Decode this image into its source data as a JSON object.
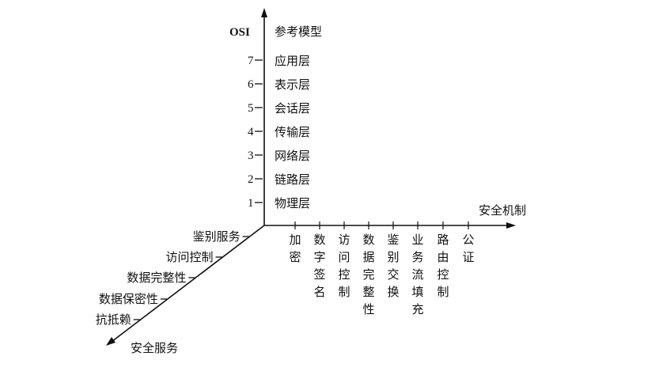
{
  "osi_axis": {
    "name": "OSI",
    "title": "参考模型",
    "layers": [
      {
        "number": "7",
        "label": "应用层"
      },
      {
        "number": "6",
        "label": "表示层"
      },
      {
        "number": "5",
        "label": "会话层"
      },
      {
        "number": "4",
        "label": "传输层"
      },
      {
        "number": "3",
        "label": "网络层"
      },
      {
        "number": "2",
        "label": "链路层"
      },
      {
        "number": "1",
        "label": "物理层"
      }
    ]
  },
  "mechanism_axis": {
    "title": "安全机制",
    "items": [
      "加密",
      "数字签名",
      "访问控制",
      "数据完整性",
      "鉴别交换",
      "业务流填充",
      "路由控制",
      "公证"
    ]
  },
  "service_axis": {
    "title": "安全服务",
    "items": [
      "鉴别服务",
      "访问控制",
      "数据完整性",
      "数据保密性",
      "抗抵赖"
    ]
  },
  "colors": {
    "line": "#111111",
    "text": "#111111",
    "background": "#ffffff"
  }
}
